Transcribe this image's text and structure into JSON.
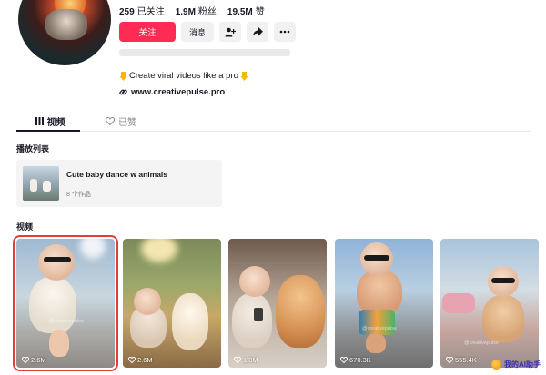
{
  "profile": {
    "stats": [
      {
        "value": "259",
        "label": "已关注"
      },
      {
        "value": "1.9M",
        "label": "粉丝"
      },
      {
        "value": "19.5M",
        "label": "赞"
      }
    ],
    "follow_label": "关注",
    "message_label": "消息",
    "bio": "Create viral videos like a pro",
    "bio_icon_left": "hand-pointing-down-icon",
    "bio_icon_right": "hand-pointing-down-icon",
    "link": "www.creativepulse.pro"
  },
  "tabs": [
    {
      "label": "视频",
      "icon": "grid-icon",
      "active": true
    },
    {
      "label": "已赞",
      "icon": "heart-outline-icon",
      "active": false
    }
  ],
  "playlist_section": {
    "title": "播放列表",
    "items": [
      {
        "title": "Cute baby dance w animals",
        "count": "8 个作品"
      }
    ]
  },
  "videos_section": {
    "title": "视频",
    "items": [
      {
        "views": "2.6M",
        "selected": true
      },
      {
        "views": "2.6M",
        "selected": false
      },
      {
        "views": "1.8M",
        "selected": false
      },
      {
        "views": "670.3K",
        "selected": false
      },
      {
        "views": "555.4K",
        "selected": false
      }
    ]
  },
  "watermark": {
    "text": "@creativepulse",
    "corner_text": "我的AI助手"
  },
  "colors": {
    "accent": "#fe2c55",
    "selection_border": "#e23d3d",
    "text_primary": "#161823",
    "text_secondary": "#8a8b91"
  }
}
